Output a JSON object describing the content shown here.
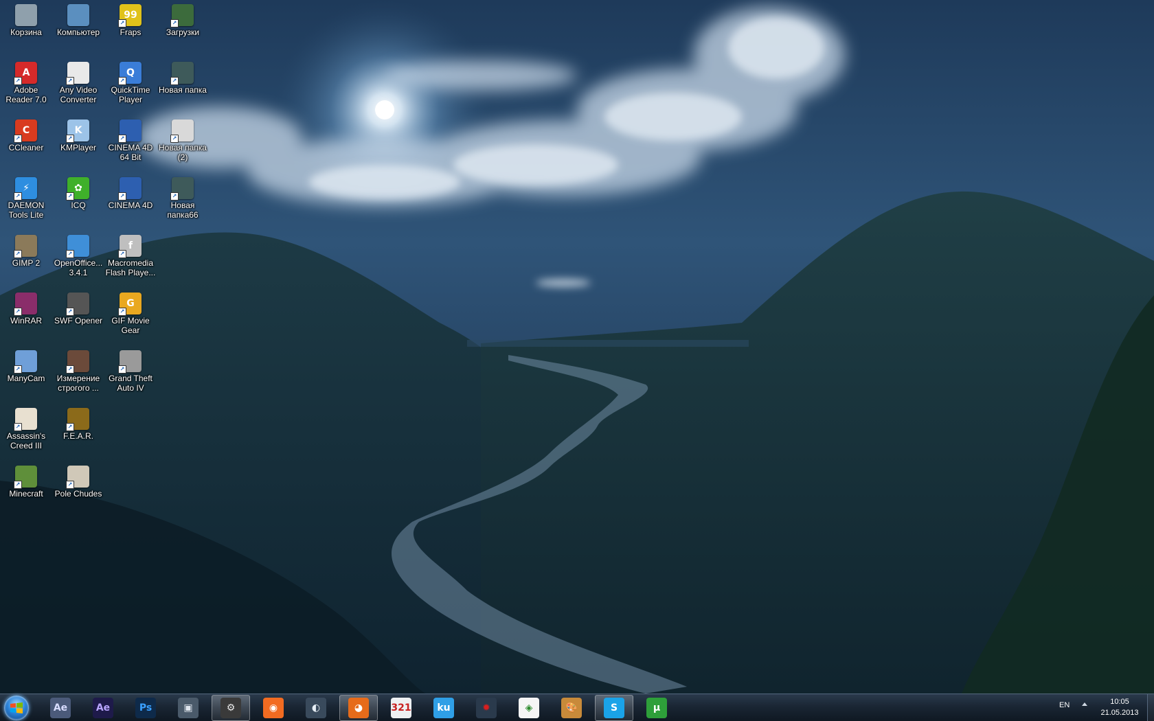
{
  "desktop": {
    "icons": [
      {
        "label": "Корзина",
        "icon": "recycle-bin-icon",
        "color": "#8fa0ac"
      },
      {
        "label": "Компьютер",
        "icon": "computer-icon",
        "color": "#5b8fbf"
      },
      {
        "label": "Fraps",
        "icon": "fraps-icon",
        "color": "#e0c21a",
        "glyph": "99"
      },
      {
        "label": "Загрузки",
        "icon": "downloads-folder-icon",
        "color": "#3c6b3c"
      },
      {
        "label": "Adobe\nReader 7.0",
        "icon": "adobe-reader-icon",
        "color": "#d62a2a",
        "glyph": "A"
      },
      {
        "label": "Any Video\nConverter",
        "icon": "any-video-converter-icon",
        "color": "#e9e9e9"
      },
      {
        "label": "QuickTime\nPlayer",
        "icon": "quicktime-icon",
        "color": "#3a7dd8",
        "glyph": "Q"
      },
      {
        "label": "Новая папка",
        "icon": "folder-icon",
        "color": "#3e5a5a"
      },
      {
        "label": "CCleaner",
        "icon": "ccleaner-icon",
        "color": "#d93b1f",
        "glyph": "C"
      },
      {
        "label": "KMPlayer",
        "icon": "kmplayer-icon",
        "color": "#9cc3e8",
        "glyph": "K"
      },
      {
        "label": "CINEMA 4D\n64 Bit",
        "icon": "cinema4d-icon",
        "color": "#2d5fb0"
      },
      {
        "label": "Новая папка\n(2)",
        "icon": "folder-icon",
        "color": "#d9d9d9"
      },
      {
        "label": "DAEMON\nTools Lite",
        "icon": "daemon-tools-icon",
        "color": "#2e8ee0",
        "glyph": "⚡"
      },
      {
        "label": "ICQ",
        "icon": "icq-flower-icon",
        "color": "#3fb02a",
        "glyph": "✿"
      },
      {
        "label": "CINEMA 4D",
        "icon": "cinema4d-icon",
        "color": "#2d5fb0"
      },
      {
        "label": "Новая\nпапка66",
        "icon": "folder-icon",
        "color": "#3e5a5a"
      },
      {
        "label": "GIMP 2",
        "icon": "gimp-icon",
        "color": "#8b7a5a"
      },
      {
        "label": "OpenOffice...\n3.4.1",
        "icon": "openoffice-icon",
        "color": "#3f8fd8"
      },
      {
        "label": "Macromedia\nFlash Playe...",
        "icon": "flash-player-icon",
        "color": "#bfbfbf",
        "glyph": "f"
      },
      {
        "label": "WinRAR",
        "icon": "winrar-icon",
        "color": "#8a2d6a"
      },
      {
        "label": "SWF Opener",
        "icon": "swf-opener-icon",
        "color": "#555"
      },
      {
        "label": "GIF Movie\nGear",
        "icon": "gif-movie-gear-icon",
        "color": "#e9a820",
        "glyph": "G"
      },
      {
        "label": "ManyCam",
        "icon": "manycam-icon",
        "color": "#6f9fd8"
      },
      {
        "label": "Измерение\nстрогого ...",
        "icon": "game-icon",
        "color": "#6b4a3a"
      },
      {
        "label": "Grand Theft\nAuto IV",
        "icon": "gta-iv-icon",
        "color": "#9a9a9a"
      },
      {
        "label": "Assassin's\nCreed III",
        "icon": "assassins-creed-icon",
        "color": "#e8e0d0"
      },
      {
        "label": "F.E.A.R.",
        "icon": "fear-eye-icon",
        "color": "#8b6a1a"
      },
      {
        "label": "Minecraft",
        "icon": "minecraft-icon",
        "color": "#5f8f3a"
      },
      {
        "label": "Pole Chudes",
        "icon": "pole-chudes-icon",
        "color": "#d0c8b8"
      }
    ]
  },
  "taskbar": {
    "items": [
      {
        "name": "after-effects-cs-icon",
        "glyph": "Ae",
        "color": "#4b5a7a",
        "fg": "#d8dcff",
        "active": false
      },
      {
        "name": "after-effects-icon",
        "glyph": "Ae",
        "color": "#1e1a4a",
        "fg": "#b9a5ff",
        "active": false
      },
      {
        "name": "photoshop-icon",
        "glyph": "Ps",
        "color": "#0e2a4a",
        "fg": "#3aa0ff",
        "active": false
      },
      {
        "name": "video-player-icon",
        "glyph": "▣",
        "color": "#4a5a6a",
        "fg": "#dfe6ee",
        "active": false
      },
      {
        "name": "settings-gear-icon",
        "glyph": "⚙",
        "color": "#3a3a3a",
        "fg": "#e8e8e8",
        "active": true
      },
      {
        "name": "origin-icon",
        "glyph": "◉",
        "color": "#f26b21",
        "fg": "#fff",
        "active": false
      },
      {
        "name": "steam-icon",
        "glyph": "◐",
        "color": "#394a5c",
        "fg": "#e6eef5",
        "active": false
      },
      {
        "name": "firefox-icon",
        "glyph": "◕",
        "color": "#e66b1a",
        "fg": "#fff",
        "active": true
      },
      {
        "name": "video-editor-icon",
        "glyph": "321",
        "color": "#eef0f2",
        "fg": "#c92020",
        "active": false
      },
      {
        "name": "kugou-icon",
        "glyph": "ku",
        "color": "#2f9fe6",
        "fg": "#fff",
        "active": false
      },
      {
        "name": "red-gear-icon",
        "glyph": "✹",
        "color": "#2a3a4c",
        "fg": "#d91e1e",
        "active": false
      },
      {
        "name": "picasa-icon",
        "glyph": "◈",
        "color": "#f5f5f5",
        "fg": "#2b8a2b",
        "active": false
      },
      {
        "name": "paint-palette-icon",
        "glyph": "🎨",
        "color": "#c88a3a",
        "fg": "#fff",
        "active": false
      },
      {
        "name": "skype-icon",
        "glyph": "S",
        "color": "#1aa3e8",
        "fg": "#fff",
        "active": true
      },
      {
        "name": "utorrent-icon",
        "glyph": "µ",
        "color": "#2e9f3a",
        "fg": "#fff",
        "active": false
      }
    ],
    "tray": {
      "language": "EN",
      "time": "10:05",
      "date": "21.05.2013"
    }
  }
}
